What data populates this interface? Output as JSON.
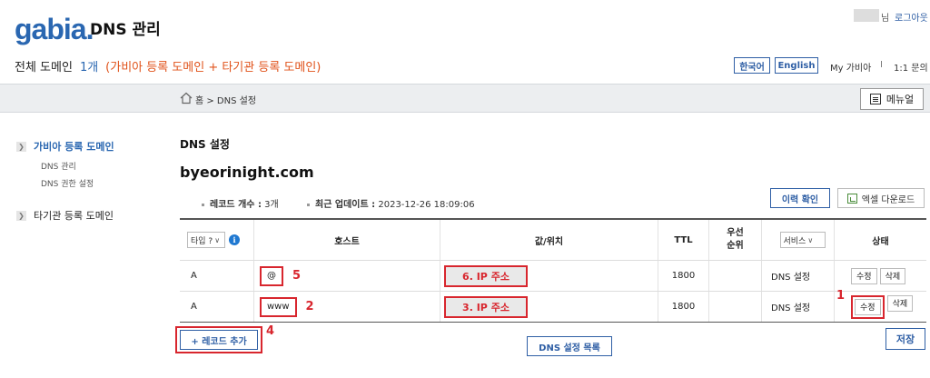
{
  "header": {
    "logo": "gabia.",
    "app_title": "DNS 관리",
    "user_suffix": "님",
    "logout": "로그아웃",
    "domain_label": "전체 도메인",
    "domain_count": "1개",
    "domain_types": "(가비아 등록 도메인 + 타기관 등록 도메인)",
    "lang_ko": "한국어",
    "lang_en": "English",
    "my_gabia": "My 가비아",
    "separator": "I",
    "contact": "1:1 문의"
  },
  "breadcrumb": {
    "text": "홈 > DNS 설정",
    "menu_label": "메뉴얼"
  },
  "sidebar": {
    "primary": "가비아 등록 도메인",
    "sub_items": [
      "DNS 관리",
      "DNS 권한 설정"
    ],
    "other": "타기관 등록 도메인"
  },
  "main": {
    "section_title": "DNS 설정",
    "domain_name": "byeorinight.com",
    "record_count_label": "레코드 개수 :",
    "record_count": "3개",
    "updated_label": "최근 업데이트 :",
    "updated_at": "2023-12-26 18:09:06",
    "history_btn": "이력 확인",
    "excel_btn": "엑셀 다운로드"
  },
  "table": {
    "headers": {
      "type": "타입",
      "host": "호스트",
      "value": "값/위치",
      "ttl": "TTL",
      "priority_line1": "우선",
      "priority_line2": "순위",
      "service": "서비스",
      "state": "상태"
    },
    "type_filter": "타입 ?",
    "service_filter": "서비스",
    "rows": [
      {
        "type": "A",
        "host": "@",
        "host_anno": "5",
        "value": "6. IP 주소",
        "ttl": "1800",
        "service": "DNS 설정",
        "edit": "수정",
        "delete": "삭제"
      },
      {
        "type": "A",
        "host": "www",
        "host_anno": "2",
        "value": "3. IP 주소",
        "ttl": "1800",
        "service": "DNS 설정",
        "edit": "수정",
        "delete": "삭제",
        "edit_anno": "1"
      }
    ]
  },
  "footer": {
    "add_record": "+ 레코드 추가",
    "add_anno": "4",
    "dns_list": "DNS 설정 목록",
    "save": "저장"
  },
  "colors": {
    "brand_blue": "#2a67b1",
    "annotation_red": "#d8262e",
    "orange": "#e0521a"
  }
}
